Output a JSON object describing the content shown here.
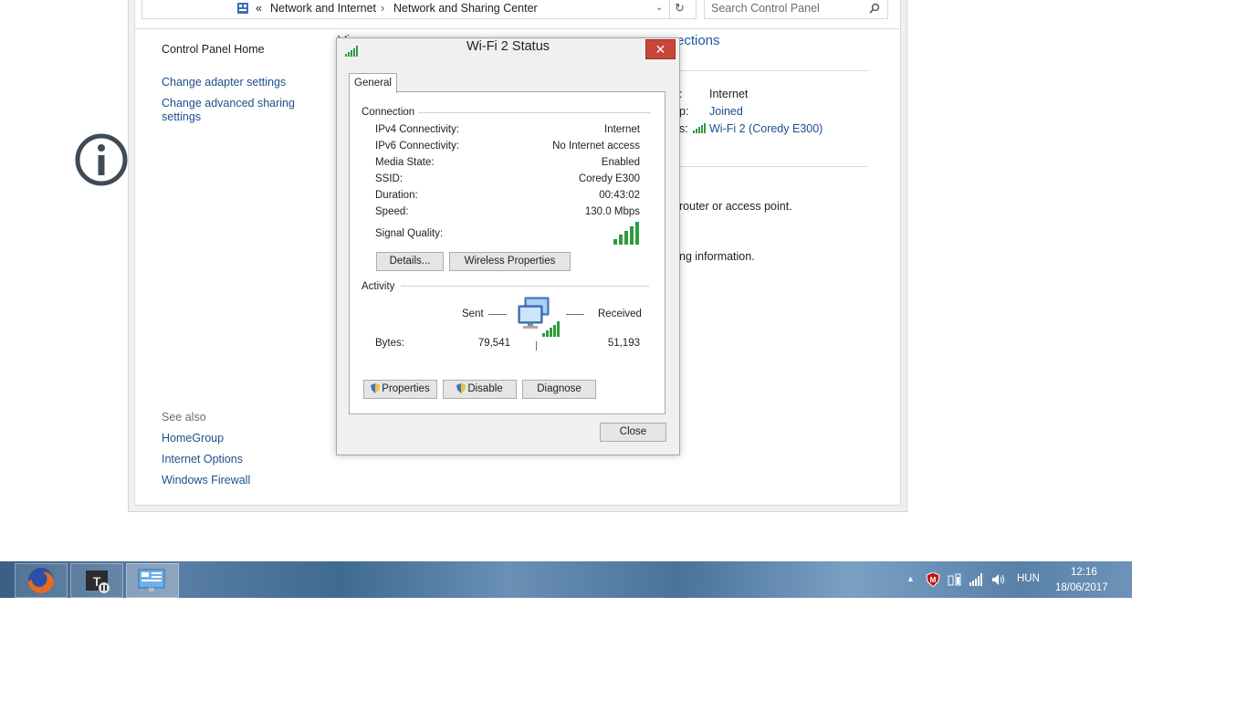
{
  "address_bar": {
    "breadcrumb_prefix": "«",
    "crumb1": "Network and Internet",
    "separator": "›",
    "crumb2": "Network and Sharing Center"
  },
  "search": {
    "placeholder": "Search Control Panel"
  },
  "sidebar": {
    "home": "Control Panel Home",
    "adapter": "Change adapter settings",
    "sharing_line1": "Change advanced sharing",
    "sharing_line2": "settings",
    "see_also": "See also",
    "homegroup": "HomeGroup",
    "internet_options": "Internet Options",
    "firewall": "Windows Firewall"
  },
  "background": {
    "heading_fragment1": "Vi",
    "heading_fragment2": "ections",
    "access_type_fragment": ":",
    "access_type_value": "Internet",
    "homegroup_fragment": "p:",
    "homegroup_value": "Joined",
    "connections_fragment": "s:",
    "connections_value": "Wi-Fi 2 (Coredy E300)",
    "router_text": "router or access point.",
    "troubleshoot_text": "ng information."
  },
  "dialog": {
    "title": "Wi-Fi 2 Status",
    "close_glyph": "✕",
    "tab_general": "General",
    "connection_group": "Connection",
    "rows": [
      {
        "label": "IPv4 Connectivity:",
        "value": "Internet"
      },
      {
        "label": "IPv6 Connectivity:",
        "value": "No Internet access"
      },
      {
        "label": "Media State:",
        "value": "Enabled"
      },
      {
        "label": "SSID:",
        "value": "Coredy E300"
      },
      {
        "label": "Duration:",
        "value": "00:43:02"
      },
      {
        "label": "Speed:",
        "value": "130.0 Mbps"
      }
    ],
    "signal_label": "Signal Quality:",
    "signal_bars": 5,
    "details_button": "Details...",
    "wireless_button": "Wireless Properties",
    "activity_group": "Activity",
    "sent_label": "Sent",
    "received_label": "Received",
    "bytes_label": "Bytes:",
    "bytes_sent": "79,541",
    "bytes_received": "51,193",
    "properties_button": "Properties",
    "disable_button": "Disable",
    "diagnose_button": "Diagnose",
    "close_button": "Close"
  },
  "taskbar": {
    "apps": [
      "firefox-icon",
      "world-of-tanks-icon",
      "control-panel-icon"
    ],
    "language": "HUN",
    "time": "12:16",
    "date": "18/06/2017"
  },
  "colors": {
    "link": "#1e4e8c",
    "signal_green": "#2e9c3e",
    "close_red": "#c7463a"
  }
}
